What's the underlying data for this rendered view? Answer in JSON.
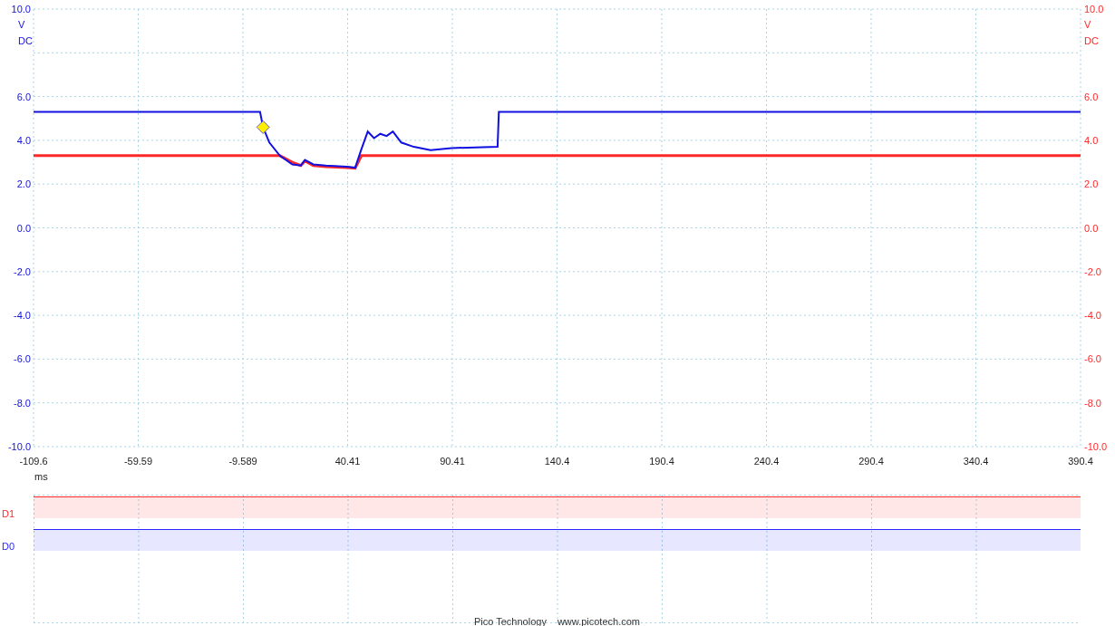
{
  "chart_data": {
    "type": "line",
    "grid": true,
    "xlabel": "ms",
    "xlim": [
      -109.6,
      390.4
    ],
    "ylim": [
      -10,
      10
    ],
    "x": [
      -109.6,
      -1.4,
      0,
      3,
      8,
      14,
      18,
      20,
      24,
      30,
      40,
      44,
      47,
      50,
      53,
      56,
      59,
      62,
      66,
      72,
      80,
      90,
      112,
      112.6,
      390.4
    ],
    "series": [
      {
        "color": "#1010e0",
        "values": [
          5.3,
          5.3,
          4.6,
          3.9,
          3.3,
          2.9,
          2.85,
          3.1,
          2.9,
          2.85,
          2.8,
          2.75,
          3.6,
          4.4,
          4.1,
          4.3,
          4.2,
          4.4,
          3.9,
          3.7,
          3.55,
          3.65,
          3.7,
          5.3,
          5.3
        ]
      },
      {
        "color": "#ff2828",
        "values": [
          3.3,
          3.3,
          3.3,
          3.3,
          3.3,
          3.0,
          2.85,
          3.05,
          2.85,
          2.8,
          2.75,
          2.72,
          3.3,
          3.3,
          3.3,
          3.3,
          3.3,
          3.3,
          3.3,
          3.3,
          3.3,
          3.3,
          3.3,
          3.3,
          3.3
        ]
      }
    ],
    "xticks": [
      {
        "value": -109.6,
        "label": "-109.6"
      },
      {
        "value": -59.59,
        "label": "-59.59"
      },
      {
        "value": -9.589,
        "label": "-9.589"
      },
      {
        "value": 40.41,
        "label": "40.41"
      },
      {
        "value": 90.41,
        "label": "90.41"
      },
      {
        "value": 140.4,
        "label": "140.4"
      },
      {
        "value": 190.4,
        "label": "190.4"
      },
      {
        "value": 240.4,
        "label": "240.4"
      },
      {
        "value": 290.4,
        "label": "290.4"
      },
      {
        "value": 340.4,
        "label": "340.4"
      },
      {
        "value": 390.4,
        "label": "390.4"
      }
    ],
    "yticks": [
      {
        "value": 10,
        "label": "10.0"
      },
      {
        "value": 6,
        "label": "6.0"
      },
      {
        "value": 4,
        "label": "4.0"
      },
      {
        "value": 2,
        "label": "2.0"
      },
      {
        "value": 0,
        "label": "0.0"
      },
      {
        "value": -2,
        "label": "-2.0"
      },
      {
        "value": -4,
        "label": "-4.0"
      },
      {
        "value": -6,
        "label": "-6.0"
      },
      {
        "value": -8,
        "label": "-8.0"
      },
      {
        "value": -10,
        "label": "-10.0"
      }
    ]
  },
  "left_axis": {
    "unit": "V",
    "coupling": "DC"
  },
  "right_axis": {
    "unit": "V",
    "coupling": "DC",
    "tick_labels": [
      "10.0",
      "6.0",
      "4.0",
      "2.0",
      "0.0",
      "-2.0",
      "-4.0",
      "-6.0",
      "-8.0",
      "-10.0"
    ]
  },
  "digital_channels": [
    {
      "name": "D1",
      "color": "#ff2828",
      "high": true
    },
    {
      "name": "D0",
      "color": "#2828ff",
      "high": true
    }
  ],
  "footer": [
    "Pico Technology",
    "www.picotech.com"
  ]
}
